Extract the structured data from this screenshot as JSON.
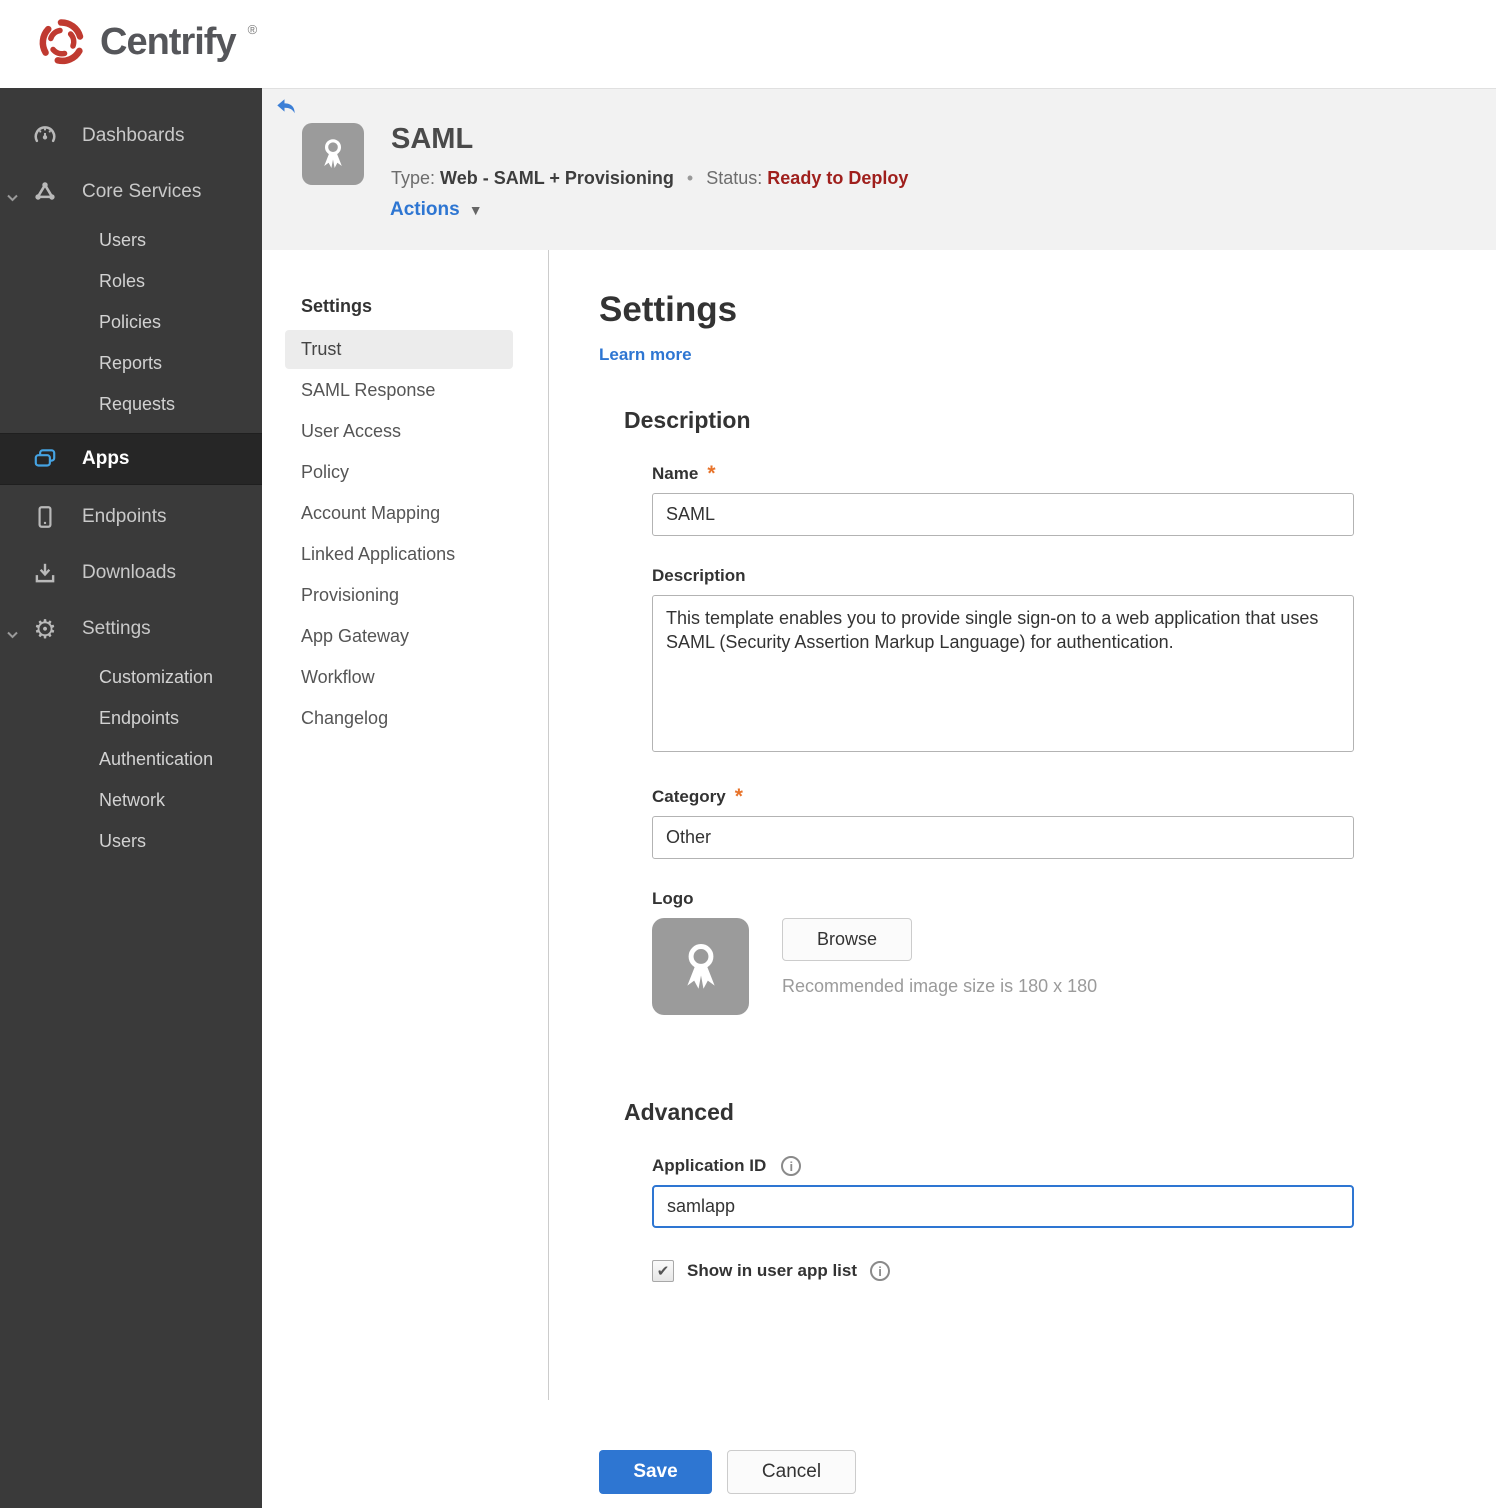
{
  "brand": {
    "name": "Centrify",
    "trademark": "®"
  },
  "icons": {
    "info": "i",
    "check": "✔",
    "caret_down": "▼"
  },
  "sidebar": {
    "items": [
      {
        "label": "Dashboards"
      },
      {
        "label": "Core Services",
        "children": [
          "Users",
          "Roles",
          "Policies",
          "Reports",
          "Requests"
        ]
      },
      {
        "label": "Apps",
        "selected": true
      },
      {
        "label": "Endpoints"
      },
      {
        "label": "Downloads"
      },
      {
        "label": "Settings",
        "children": [
          "Customization",
          "Endpoints",
          "Authentication",
          "Network",
          "Users"
        ]
      }
    ]
  },
  "app_header": {
    "title": "SAML",
    "type_label": "Type:",
    "type_value": "Web - SAML + Provisioning",
    "separator": "•",
    "status_label": "Status:",
    "status_value": "Ready to Deploy",
    "actions_label": "Actions"
  },
  "subnav": {
    "header": "Settings",
    "selected": "Trust",
    "items": [
      "Trust",
      "SAML Response",
      "User Access",
      "Policy",
      "Account Mapping",
      "Linked Applications",
      "Provisioning",
      "App Gateway",
      "Workflow",
      "Changelog"
    ]
  },
  "main": {
    "title": "Settings",
    "learn_more": "Learn more",
    "required_marker": "*",
    "description": {
      "heading": "Description",
      "name_label": "Name",
      "name_value": "SAML",
      "description_label": "Description",
      "description_value": "This template enables you to provide single sign-on to a web application that uses SAML (Security Assertion Markup Language) for authentication.",
      "category_label": "Category",
      "category_value": "Other",
      "logo_label": "Logo",
      "browse_label": "Browse",
      "logo_hint": "Recommended image size is 180 x 180"
    },
    "advanced": {
      "heading": "Advanced",
      "app_id_label": "Application ID",
      "app_id_value": "samlapp",
      "show_label": "Show in user app list",
      "checkbox_checked": true
    },
    "footer": {
      "save": "Save",
      "cancel": "Cancel"
    }
  },
  "colors": {
    "accent_blue": "#2e76d2",
    "status_red": "#9f1f1c",
    "required_orange": "#e8732a",
    "apps_icon_blue": "#45a3e2",
    "sidebar_bg": "#3a3a3a",
    "selected_row": "#262626",
    "header_band": "#f2f2f2",
    "brand_red": "#c03a30"
  }
}
